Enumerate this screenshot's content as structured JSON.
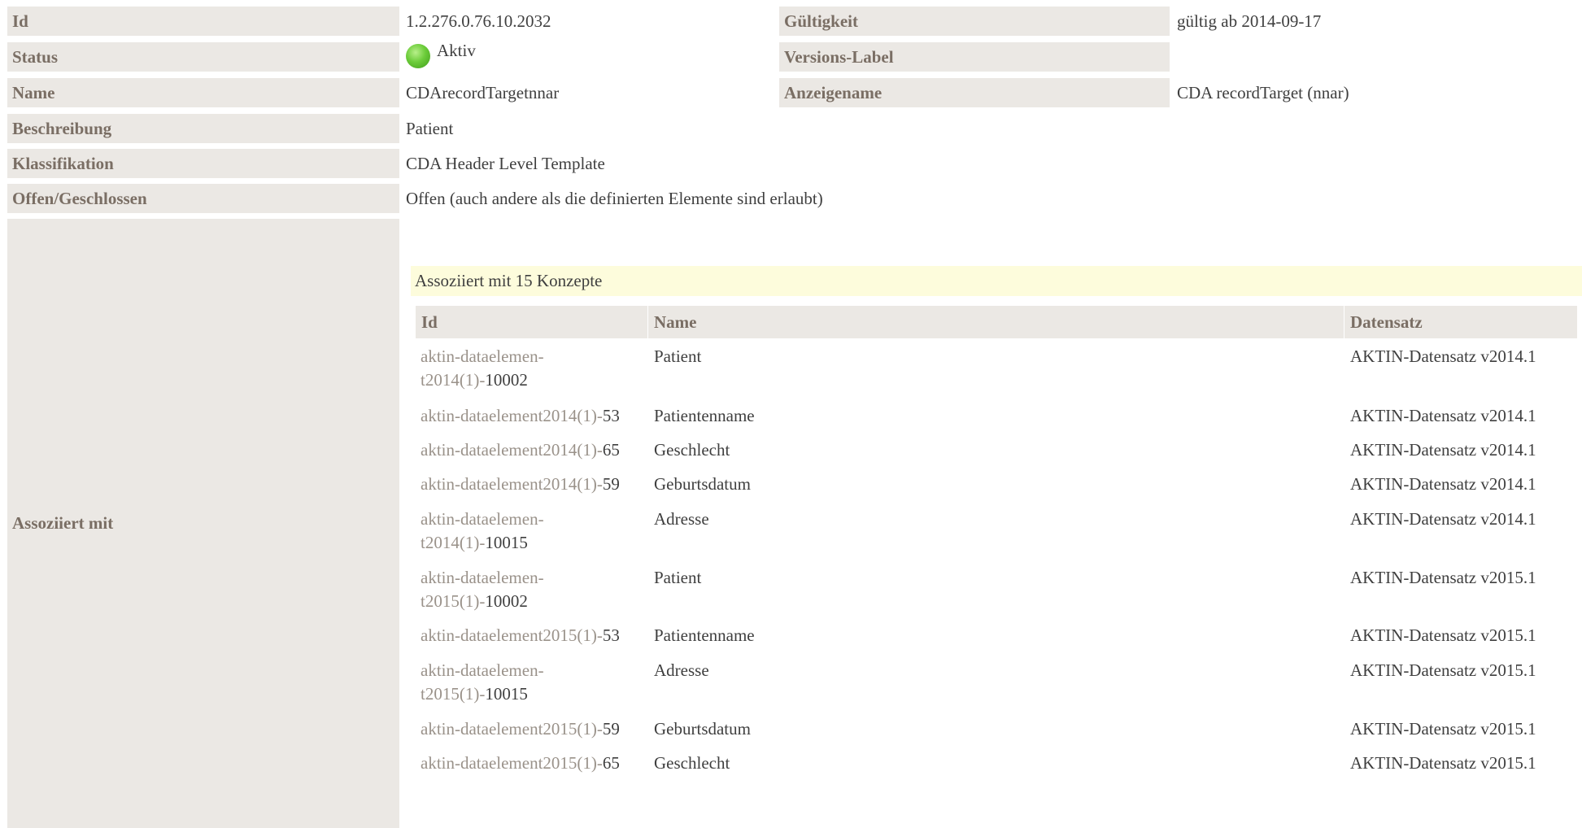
{
  "fields": {
    "id": {
      "label": "Id",
      "value": "1.2.276.0.76.10.2032"
    },
    "gueltigkeit": {
      "label": "Gültigkeit",
      "value": "gültig ab 2014-09-17"
    },
    "status": {
      "label": "Status",
      "value": "Aktiv"
    },
    "versions_label": {
      "label": "Versions-Label",
      "value": ""
    },
    "name": {
      "label": "Name",
      "value": "CDArecordTargetnnar"
    },
    "anzeigename": {
      "label": "Anzeigename",
      "value": "CDA recordTarget (nnar)"
    },
    "beschreibung": {
      "label": "Beschreibung",
      "value": "Patient"
    },
    "klassifikation": {
      "label": "Klassifikation",
      "value": "CDA Header Level Template"
    },
    "offen": {
      "label": "Offen/Geschlossen",
      "value": "Offen (auch andere als die definierten Elemente sind erlaubt)"
    },
    "assoziiert": {
      "label": "Assoziiert mit"
    }
  },
  "colors": {
    "status_active": "#6ccc3a",
    "label_bg": "#ebe8e4",
    "banner_bg": "#fdfcdc"
  },
  "associations": {
    "banner": "Assoziiert mit 15 Konzepte",
    "headers": {
      "id": "Id",
      "name": "Name",
      "dataset": "Datensatz"
    },
    "rows": [
      {
        "id_line1": "aktin-dataelemen-",
        "id_prefix": "t2014(1)-",
        "id_num": "10002",
        "name": "Patient",
        "dataset": "AKTIN-Datensatz v2014.1"
      },
      {
        "id_line1": "",
        "id_prefix": "aktin-dataelement2014(1)-",
        "id_num": "53",
        "name": "Patientenname",
        "dataset": "AKTIN-Datensatz v2014.1"
      },
      {
        "id_line1": "",
        "id_prefix": "aktin-dataelement2014(1)-",
        "id_num": "65",
        "name": "Geschlecht",
        "dataset": "AKTIN-Datensatz v2014.1"
      },
      {
        "id_line1": "",
        "id_prefix": "aktin-dataelement2014(1)-",
        "id_num": "59",
        "name": "Geburtsdatum",
        "dataset": "AKTIN-Datensatz v2014.1"
      },
      {
        "id_line1": "aktin-dataelemen-",
        "id_prefix": "t2014(1)-",
        "id_num": "10015",
        "name": "Adresse",
        "dataset": "AKTIN-Datensatz v2014.1"
      },
      {
        "id_line1": "aktin-dataelemen-",
        "id_prefix": "t2015(1)-",
        "id_num": "10002",
        "name": "Patient",
        "dataset": "AKTIN-Datensatz v2015.1"
      },
      {
        "id_line1": "",
        "id_prefix": "aktin-dataelement2015(1)-",
        "id_num": "53",
        "name": "Patientenname",
        "dataset": "AKTIN-Datensatz v2015.1"
      },
      {
        "id_line1": "aktin-dataelemen-",
        "id_prefix": "t2015(1)-",
        "id_num": "10015",
        "name": "Adresse",
        "dataset": "AKTIN-Datensatz v2015.1"
      },
      {
        "id_line1": "",
        "id_prefix": "aktin-dataelement2015(1)-",
        "id_num": "59",
        "name": "Geburtsdatum",
        "dataset": "AKTIN-Datensatz v2015.1"
      },
      {
        "id_line1": "",
        "id_prefix": "aktin-dataelement2015(1)-",
        "id_num": "65",
        "name": "Geschlecht",
        "dataset": "AKTIN-Datensatz v2015.1"
      }
    ]
  }
}
